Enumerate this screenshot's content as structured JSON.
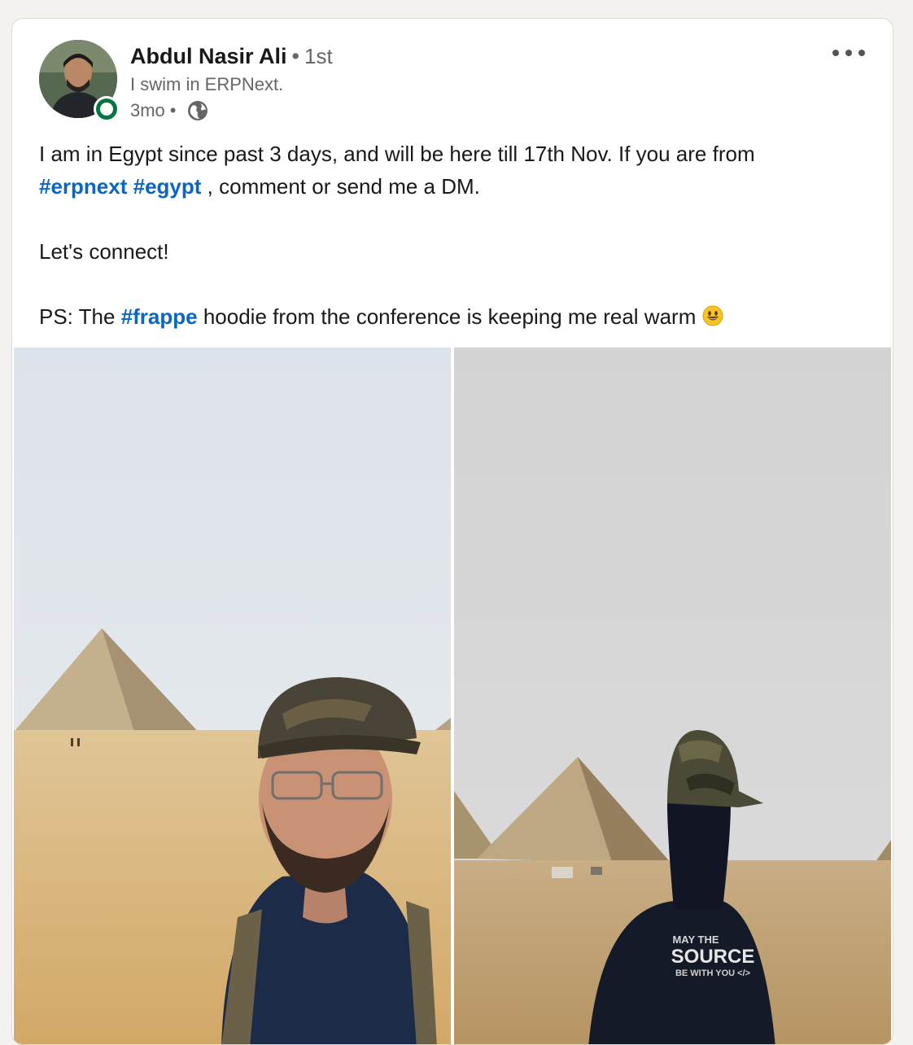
{
  "post": {
    "author": {
      "name": "Abdul Nasir Ali",
      "degree": "1st",
      "headline": "I swim in ERPNext.",
      "time": "3mo",
      "online": true,
      "visibility_icon": "globe-icon"
    },
    "body": {
      "line1": "I am in Egypt since past 3 days, and will be here till 17th Nov. If you are from",
      "hashtag_erpnext": "#erpnext",
      "hashtag_egypt": "#egypt",
      "line2_rest": " , comment or send me a DM.",
      "line3": "Let's connect!",
      "line4_start": "PS: The ",
      "hashtag_frappe": "#frappe",
      "line4_end": " hoodie from the conference is keeping me real warm ",
      "emoji": "smiley-emoji"
    },
    "photos": [
      {
        "name": "selfie-at-pyramids"
      },
      {
        "name": "back-view-at-pyramids",
        "hoodie_line1": "MAY THE",
        "hoodie_line2": "SOURCE",
        "hoodie_line3": "BE WITH YOU </>"
      }
    ],
    "menu_icon": "more-options-icon"
  },
  "colors": {
    "link": "#0a66c2",
    "online": "#057642",
    "secondary_text": "#666666",
    "background": "#f4f2ee"
  }
}
